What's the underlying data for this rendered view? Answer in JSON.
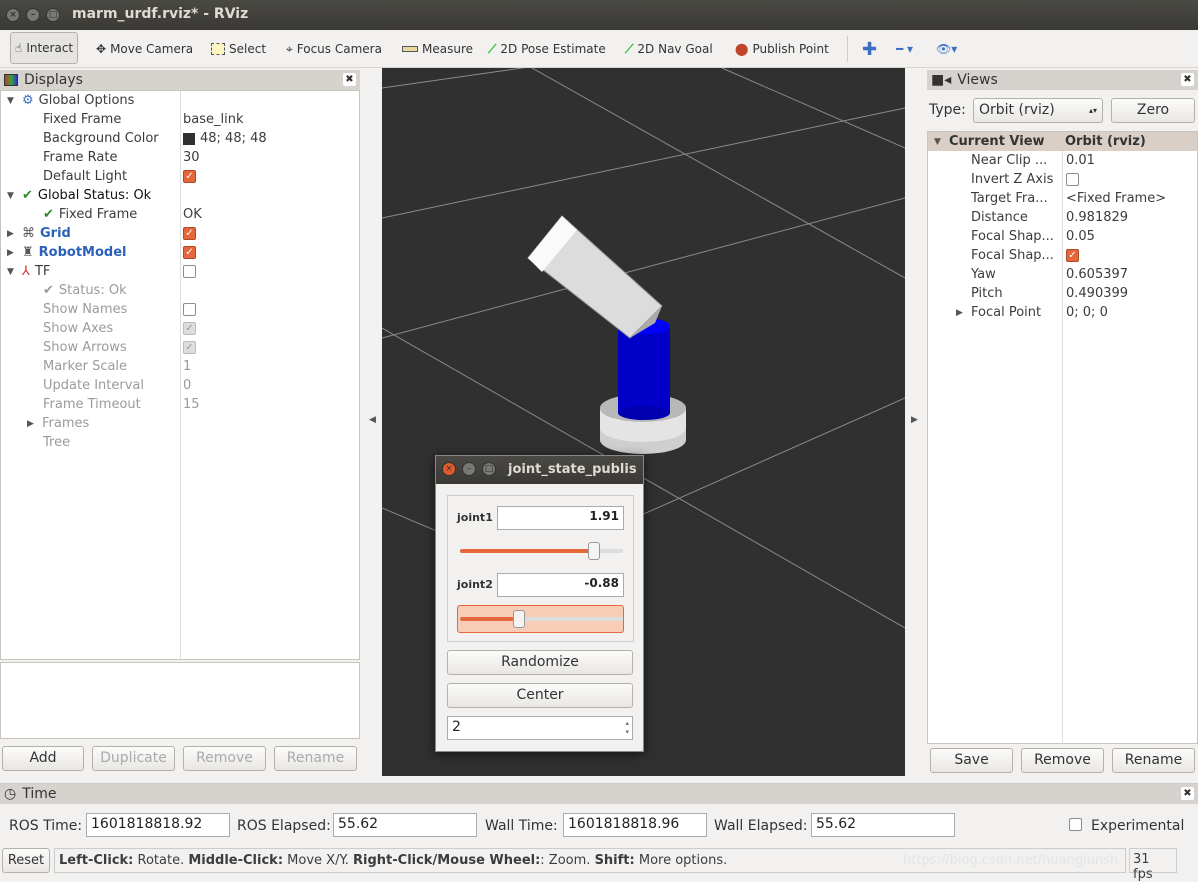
{
  "window": {
    "title": "marm_urdf.rviz* - RViz"
  },
  "toolbar": {
    "items": [
      {
        "label": "Interact",
        "icon": "hand-icon"
      },
      {
        "label": "Move Camera",
        "icon": "move-camera-icon"
      },
      {
        "label": "Select",
        "icon": "select-icon"
      },
      {
        "label": "Focus Camera",
        "icon": "focus-camera-icon"
      },
      {
        "label": "Measure",
        "icon": "ruler-icon"
      },
      {
        "label": "2D Pose Estimate",
        "icon": "green-arrow-icon"
      },
      {
        "label": "2D Nav Goal",
        "icon": "green-arrow-icon"
      },
      {
        "label": "Publish Point",
        "icon": "map-pin-icon"
      }
    ]
  },
  "displays": {
    "title": "Displays",
    "rows": [
      {
        "label": "Global Options",
        "value": ""
      },
      {
        "label": "Fixed Frame",
        "value": "base_link"
      },
      {
        "label": "Background Color",
        "value": "48; 48; 48",
        "color": "#303030"
      },
      {
        "label": "Frame Rate",
        "value": "30"
      },
      {
        "label": "Default Light",
        "value": ""
      },
      {
        "label": "Global Status: Ok",
        "value": ""
      },
      {
        "label": "Fixed Frame",
        "value": "OK"
      },
      {
        "label": "Grid",
        "value": ""
      },
      {
        "label": "RobotModel",
        "value": ""
      },
      {
        "label": "TF",
        "value": ""
      },
      {
        "label": "Status: Ok",
        "value": ""
      },
      {
        "label": "Show Names",
        "value": ""
      },
      {
        "label": "Show Axes",
        "value": ""
      },
      {
        "label": "Show Arrows",
        "value": ""
      },
      {
        "label": "Marker Scale",
        "value": "1"
      },
      {
        "label": "Update Interval",
        "value": "0"
      },
      {
        "label": "Frame Timeout",
        "value": "15"
      },
      {
        "label": "Frames",
        "value": ""
      },
      {
        "label": "Tree",
        "value": ""
      }
    ],
    "buttons": {
      "add": "Add",
      "duplicate": "Duplicate",
      "remove": "Remove",
      "rename": "Rename"
    }
  },
  "views": {
    "title": "Views",
    "type_label": "Type:",
    "type_value": "Orbit (rviz)",
    "zero": "Zero",
    "header": {
      "k": "Current View",
      "v": "Orbit (rviz)"
    },
    "rows": [
      {
        "k": "Near Clip ...",
        "v": "0.01"
      },
      {
        "k": "Invert Z Axis",
        "v": ""
      },
      {
        "k": "Target Fra...",
        "v": "<Fixed Frame>"
      },
      {
        "k": "Distance",
        "v": "0.981829"
      },
      {
        "k": "Focal Shap...",
        "v": "0.05"
      },
      {
        "k": "Focal Shap...",
        "v": ""
      },
      {
        "k": "Yaw",
        "v": "0.605397"
      },
      {
        "k": "Pitch",
        "v": "0.490399"
      },
      {
        "k": "Focal Point",
        "v": "0; 0; 0"
      }
    ],
    "buttons": {
      "save": "Save",
      "remove": "Remove",
      "rename": "Rename"
    }
  },
  "joint_dialog": {
    "title": "joint_state_publis",
    "joints": [
      {
        "name": "joint1",
        "value": "1.91",
        "fraction": 0.82
      },
      {
        "name": "joint2",
        "value": "-0.88",
        "fraction": 0.36
      }
    ],
    "randomize": "Randomize",
    "center": "Center",
    "spin_value": "2"
  },
  "time": {
    "title": "Time",
    "ros_time_label": "ROS Time:",
    "ros_time": "1601818818.92",
    "ros_elapsed_label": "ROS Elapsed:",
    "ros_elapsed": "55.62",
    "wall_time_label": "Wall Time:",
    "wall_time": "1601818818.96",
    "wall_elapsed_label": "Wall Elapsed:",
    "wall_elapsed": "55.62",
    "experimental": "Experimental"
  },
  "status": {
    "reset": "Reset",
    "b1": "Left-Click:",
    "t1": " Rotate. ",
    "b2": "Middle-Click:",
    "t2": " Move X/Y. ",
    "b3": "Right-Click/Mouse Wheel:",
    "t3": ": Zoom. ",
    "b4": "Shift:",
    "t4": " More options.",
    "fps": "31 fps",
    "watermark": "https://blog.csdn.net/huangjunsh"
  }
}
